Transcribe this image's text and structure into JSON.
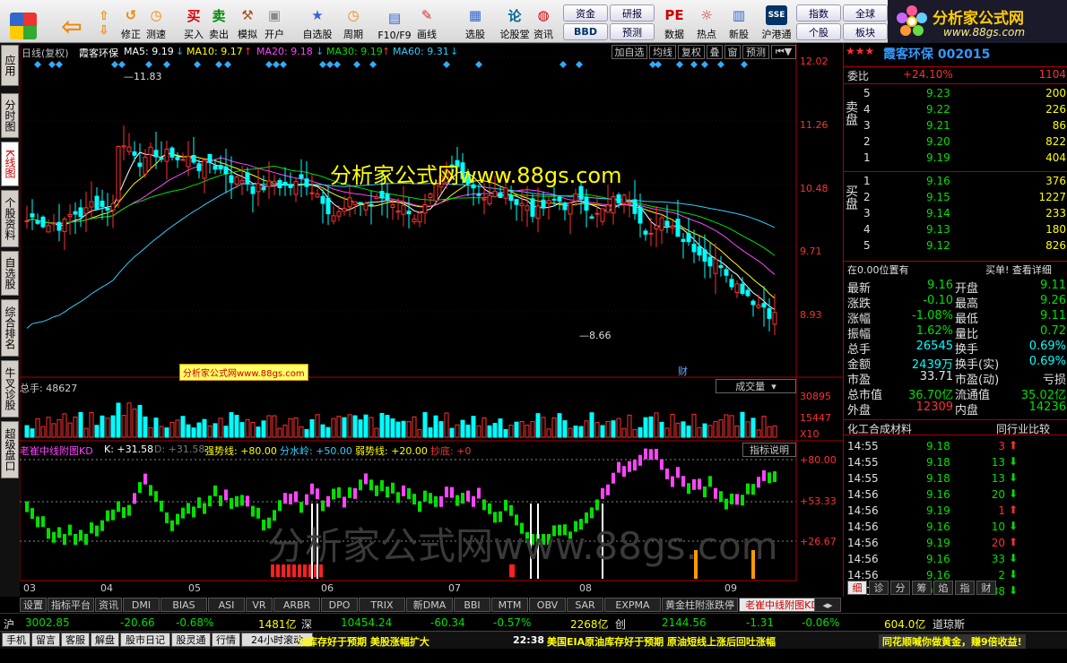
{
  "toolbar": {
    "items": [
      {
        "label": "修正",
        "icon": "undo-icon"
      },
      {
        "label": "测速",
        "icon": "clock-icon"
      },
      {
        "label": "买入",
        "icon": "buy-icon"
      },
      {
        "label": "卖出",
        "icon": "sell-icon"
      },
      {
        "label": "模拟",
        "icon": "hammer-icon"
      },
      {
        "label": "开户",
        "icon": "lock-icon"
      },
      {
        "label": "自选股",
        "icon": "star-icon"
      },
      {
        "label": "周期",
        "icon": "clock-icon"
      },
      {
        "label": "F10/F9",
        "icon": "chart-icon"
      },
      {
        "label": "画线",
        "icon": "pen-icon"
      },
      {
        "label": "选股",
        "icon": "filter-icon"
      },
      {
        "label": "论股堂",
        "icon": "lun-icon"
      },
      {
        "label": "资讯",
        "icon": "news-icon"
      },
      {
        "label": "数据",
        "icon": "pe-icon"
      },
      {
        "label": "热点",
        "icon": "hot-icon"
      },
      {
        "label": "新股",
        "icon": "doc-icon"
      },
      {
        "label": "沪港通",
        "icon": "sse-icon"
      }
    ],
    "small_buttons": [
      "资金",
      "研报",
      "BBD",
      "预测",
      "指数",
      "全球",
      "个股",
      "板块"
    ],
    "logo_title": "分析家公式网",
    "logo_url": "www.88gs.com"
  },
  "left_tabs": [
    "应用",
    "分时图",
    "K线图",
    "个股资料",
    "自选股",
    "综合排名",
    "牛叉诊股",
    "超级盘口"
  ],
  "chart_header": {
    "period_label": "日线(复权)",
    "stock_name": "霞客环保",
    "ma5": "MA5: 9.19",
    "ma10": "MA10: 9.17",
    "ma20": "MA20: 9.18",
    "ma30": "MA30: 9.19",
    "ma60": "MA60: 9.31",
    "buttons": [
      "加自选",
      "均线",
      "复权",
      "叠",
      "窗",
      "预测"
    ]
  },
  "watermark": "分析家公式网www.88gs.com",
  "watermark_small": "分析家公式网www.88gs.com",
  "watermark_big": "分析家公式网www.88gs.com",
  "price_axis": [
    "12.02",
    "11.26",
    "10.48",
    "9.71",
    "8.93"
  ],
  "price_marks": {
    "high": "11.83",
    "low": "8.66"
  },
  "cai_label": "财",
  "volume": {
    "label": "总手: 48627",
    "selector": "成交量",
    "axis": [
      "30895",
      "15447",
      "X10"
    ]
  },
  "indicator": {
    "name": "老崔中线附图KD",
    "k": "K: +31.58",
    "d": "D: +31.58",
    "strong": "强势线: +80.00",
    "divide": "分水岭: +50.00",
    "weak": "弱势线: +20.00",
    "bottom": "抄底: +0",
    "help": "指标说明",
    "axis": [
      "+80.00",
      "+53.33",
      "+26.67"
    ]
  },
  "x_axis": [
    "03",
    "04",
    "05",
    "06",
    "07",
    "08",
    "09"
  ],
  "bottom_tabs": [
    "设置",
    "指标平台",
    "资讯",
    "DMI",
    "BIAS",
    "ASI",
    "VR",
    "ARBR",
    "DPO",
    "TRIX",
    "新DMA",
    "BBI",
    "MTM",
    "OBV",
    "SAR",
    "EXPMA",
    "黄金柱附涨跌停",
    "老崔中线附图KD"
  ],
  "quote": {
    "stars": "★★★",
    "title": "霞客环保 002015",
    "weibi_label": "委比",
    "weibi": "+24.10%",
    "weicha": "1104",
    "sell_label": "卖盘",
    "buy_label": "买盘",
    "sell": [
      {
        "lvl": "5",
        "price": "9.23",
        "vol": "200"
      },
      {
        "lvl": "4",
        "price": "9.22",
        "vol": "226"
      },
      {
        "lvl": "3",
        "price": "9.21",
        "vol": "86"
      },
      {
        "lvl": "2",
        "price": "9.20",
        "vol": "822"
      },
      {
        "lvl": "1",
        "price": "9.19",
        "vol": "404"
      }
    ],
    "buy": [
      {
        "lvl": "1",
        "price": "9.16",
        "vol": "376"
      },
      {
        "lvl": "2",
        "price": "9.15",
        "vol": "1227"
      },
      {
        "lvl": "3",
        "price": "9.14",
        "vol": "233"
      },
      {
        "lvl": "4",
        "price": "9.13",
        "vol": "180"
      },
      {
        "lvl": "5",
        "price": "9.12",
        "vol": "826"
      }
    ],
    "pos_text": "在0.00位置有",
    "pos_right": "买单! 查看详细",
    "stats": [
      {
        "l1": "最新",
        "v1": "9.16",
        "l2": "开盘",
        "v2": "9.11"
      },
      {
        "l1": "涨跌",
        "v1": "-0.10",
        "l2": "最高",
        "v2": "9.26"
      },
      {
        "l1": "涨幅",
        "v1": "-1.08%",
        "l2": "最低",
        "v2": "9.11"
      },
      {
        "l1": "振幅",
        "v1": "1.62%",
        "l2": "量比",
        "v2": "0.72"
      },
      {
        "l1": "总手",
        "v1": "26545",
        "l2": "换手",
        "v2": "0.69%"
      },
      {
        "l1": "金额",
        "v1": "2439万",
        "l2": "换手(实)",
        "v2": "0.69%"
      },
      {
        "l1": "市盈",
        "v1": "33.71",
        "l2": "市盈(动)",
        "v2": "亏损"
      },
      {
        "l1": "总市值",
        "v1": "36.70亿",
        "l2": "流通值",
        "v2": "35.02亿"
      },
      {
        "l1": "外盘",
        "v1": "12309",
        "l2": "内盘",
        "v2": "14236"
      }
    ],
    "industry": "化工合成材料",
    "compare": "同行业比较",
    "ticks": [
      {
        "t": "14:55",
        "p": "9.18",
        "v": "3",
        "dir": "up"
      },
      {
        "t": "14:55",
        "p": "9.18",
        "v": "13",
        "dir": "down"
      },
      {
        "t": "14:55",
        "p": "9.18",
        "v": "13",
        "dir": "down"
      },
      {
        "t": "14:56",
        "p": "9.16",
        "v": "20",
        "dir": "down"
      },
      {
        "t": "14:56",
        "p": "9.19",
        "v": "1",
        "dir": "up"
      },
      {
        "t": "14:56",
        "p": "9.16",
        "v": "10",
        "dir": "down"
      },
      {
        "t": "14:56",
        "p": "9.19",
        "v": "20",
        "dir": "up"
      },
      {
        "t": "14:56",
        "p": "9.16",
        "v": "33",
        "dir": "down"
      },
      {
        "t": "14:56",
        "p": "9.16",
        "v": "2",
        "dir": "down"
      },
      {
        "t": "15:00",
        "p": "9.16",
        "v": "288",
        "dir": "down"
      }
    ],
    "bottom_tabs": [
      "细",
      "诊",
      "分",
      "筹",
      "焰",
      "指",
      "财"
    ]
  },
  "index_bar": {
    "sh_label": "沪",
    "sh": "3002.85",
    "sh_chg": "-20.66",
    "sh_pct": "-0.68%",
    "sh_amt": "1481亿",
    "sz_label": "深",
    "sz": "10454.24",
    "sz_chg": "-60.34",
    "sz_pct": "-0.57%",
    "sz_amt": "2268亿",
    "cy_label": "创",
    "cy": "2144.56",
    "cy_chg": "-1.31",
    "cy_pct": "-0.06%",
    "cy_amt": "604.0亿",
    "dj": "道琼斯"
  },
  "news_bar": {
    "buttons": [
      "手机",
      "留言",
      "客服",
      "解盘",
      "股市日记",
      "股灵通",
      "行情",
      "24小时滚动"
    ],
    "headline1": "油库存好于预期 美股涨幅扩大",
    "time": "22:38",
    "headline2": "美国EIA原油库存好于预期 原油短线上涨后回吐涨幅",
    "ad": "同花顺喊你做黄金，赚9倍收益!"
  }
}
